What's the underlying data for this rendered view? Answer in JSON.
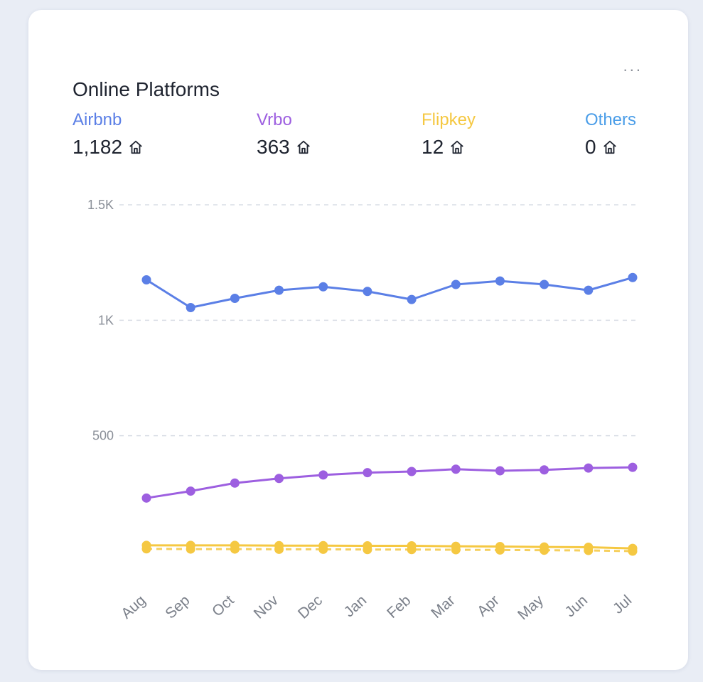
{
  "header": {
    "title": "Online Platforms",
    "more_label": "..."
  },
  "platforms": [
    {
      "name": "Airbnb",
      "value": "1,182",
      "color": "#5b7fe6"
    },
    {
      "name": "Vrbo",
      "value": "363",
      "color": "#9d5fe0"
    },
    {
      "name": "Flipkey",
      "value": "12",
      "color": "#f5c842"
    },
    {
      "name": "Others",
      "value": "0",
      "color": "#4a9de8"
    }
  ],
  "icons": {
    "stat_icon": "home-icon",
    "menu_icon": "more-horizontal-icon"
  },
  "chart_data": {
    "type": "line",
    "categories": [
      "Aug",
      "Sep",
      "Oct",
      "Nov",
      "Dec",
      "Jan",
      "Feb",
      "Mar",
      "Apr",
      "May",
      "Jun",
      "Jul"
    ],
    "series": [
      {
        "name": "Airbnb",
        "color": "#5b7fe6",
        "values": [
          1175,
          1055,
          1095,
          1130,
          1145,
          1125,
          1090,
          1155,
          1170,
          1155,
          1130,
          1185
        ]
      },
      {
        "name": "Vrbo",
        "color": "#9d5fe0",
        "values": [
          230,
          260,
          295,
          315,
          330,
          340,
          345,
          355,
          348,
          352,
          360,
          363
        ]
      },
      {
        "name": "Flipkey",
        "color": "#f5c842",
        "values": [
          25,
          25,
          25,
          24,
          24,
          23,
          23,
          21,
          20,
          18,
          17,
          12
        ]
      },
      {
        "name": "Others",
        "color": "#f5c842",
        "values": [
          10,
          9,
          9,
          8,
          8,
          7,
          7,
          6,
          5,
          4,
          3,
          0
        ]
      }
    ],
    "yticks": [
      {
        "value": 500,
        "label": "500"
      },
      {
        "value": 1000,
        "label": "1K"
      },
      {
        "value": 1500,
        "label": "1.5K"
      }
    ],
    "ylim": [
      0,
      1500
    ],
    "grid": true,
    "legend": "top"
  }
}
